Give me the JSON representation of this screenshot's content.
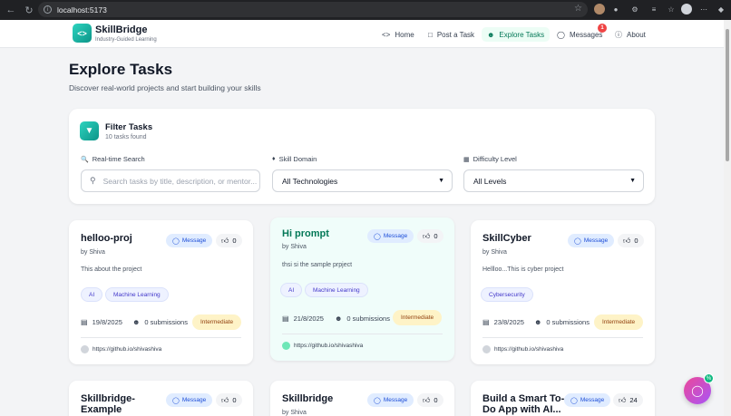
{
  "browser": {
    "url": "localhost:5173"
  },
  "header": {
    "brand": "SkillBridge",
    "tagline": "Industry-Guided Learning",
    "nav": [
      {
        "label": "Home",
        "icon": "code-icon"
      },
      {
        "label": "Post a Task",
        "icon": "book-icon"
      },
      {
        "label": "Explore Tasks",
        "icon": "users-icon",
        "active": true
      },
      {
        "label": "Messages",
        "icon": "chat-icon",
        "badge": "1"
      },
      {
        "label": "About",
        "icon": "info-icon"
      }
    ]
  },
  "page": {
    "title": "Explore Tasks",
    "subtitle": "Discover real-world projects and start building your skills"
  },
  "filter": {
    "title": "Filter Tasks",
    "count": "10 tasks found",
    "search_label": "Real-time Search",
    "search_placeholder": "Search tasks by title, description, or mentor...",
    "domain_label": "Skill Domain",
    "domain_value": "All Technologies",
    "difficulty_label": "Difficulty Level",
    "difficulty_value": "All Levels"
  },
  "cards": [
    {
      "title": "helloo-proj",
      "author": "by Shiva",
      "message_label": "Message",
      "likes": "0",
      "description": "This about the project",
      "tags": [
        "AI",
        "Machine Learning"
      ],
      "date": "19/8/2025",
      "submissions": "0 submissions",
      "level": "Intermediate",
      "link": "https://github.io/shivashiva"
    },
    {
      "title": "Hi prompt",
      "author": "by Shiva",
      "message_label": "Message",
      "likes": "0",
      "description": "thsi si the sample prpject",
      "tags": [
        "AI",
        "Machine Learning"
      ],
      "date": "21/8/2025",
      "submissions": "0 submissions",
      "level": "Intermediate",
      "link": "https://github.io/shivashiva"
    },
    {
      "title": "SkillCyber",
      "author": "by Shiva",
      "message_label": "Message",
      "likes": "0",
      "description": "Hellloo...This is cyber project",
      "tags": [
        "Cybersecurity"
      ],
      "date": "23/8/2025",
      "submissions": "0 submissions",
      "level": "Intermediate",
      "link": "https://github.io/shivashiva"
    },
    {
      "title": "Skillbridge-Example",
      "author": "",
      "message_label": "Message",
      "likes": "0"
    },
    {
      "title": "Skillbridge",
      "author": "by Shiva",
      "message_label": "Message",
      "likes": "0"
    },
    {
      "title": "Build a Smart To-Do App with AI...",
      "author": "",
      "message_label": "Message",
      "likes": "24"
    }
  ],
  "fab": {
    "badge": "%"
  }
}
